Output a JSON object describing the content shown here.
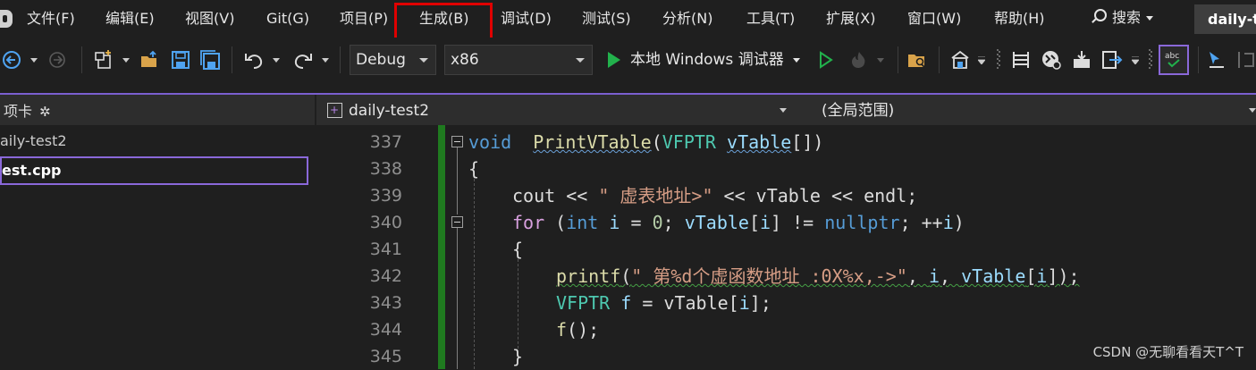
{
  "menubar": {
    "items": [
      {
        "label": "文件(F)"
      },
      {
        "label": "编辑(E)"
      },
      {
        "label": "视图(V)"
      },
      {
        "label": "Git(G)"
      },
      {
        "label": "项目(P)"
      },
      {
        "label": "生成(B)"
      },
      {
        "label": "调试(D)"
      },
      {
        "label": "测试(S)"
      },
      {
        "label": "分析(N)"
      },
      {
        "label": "工具(T)"
      },
      {
        "label": "扩展(X)"
      },
      {
        "label": "窗口(W)"
      },
      {
        "label": "帮助(H)"
      }
    ],
    "highlighted_item": "生成(B)",
    "highlight_color": "#e00000",
    "search_label": "搜索",
    "solution_name": "daily-t"
  },
  "toolbar": {
    "configuration": "Debug",
    "platform": "x86",
    "debugger_label": "本地 Windows 调试器",
    "icons": [
      "back-icon",
      "forward-icon",
      "new-project-icon",
      "open-file-icon",
      "save-icon",
      "save-all-icon",
      "undo-icon",
      "redo-icon",
      "start-debug-icon",
      "start-without-debug-icon",
      "hot-reload-icon",
      "find-in-files-icon",
      "toolbar-icon-a",
      "toolbar-icon-b",
      "toolbar-icon-c",
      "toolbar-icon-d",
      "toolbar-icon-e",
      "spell-check-icon",
      "pointer-icon"
    ]
  },
  "left_panel": {
    "header": "项卡",
    "items": [
      {
        "label": "aily-test2",
        "selected": false
      },
      {
        "label": "est.cpp",
        "selected": true
      }
    ]
  },
  "editor": {
    "file_combo": "daily-test2",
    "scope_combo": "(全局范围)",
    "lines": [
      {
        "num": "337",
        "tokens": [
          [
            "kw",
            "void"
          ],
          [
            "",
            "  "
          ],
          [
            "fn squig-b",
            "PrintVTable"
          ],
          [
            "",
            "("
          ],
          [
            "typ",
            "VFPTR"
          ],
          [
            "",
            " "
          ],
          [
            "par squig-b",
            "vTable"
          ],
          [
            "",
            "[])"
          ]
        ]
      },
      {
        "num": "338",
        "tokens": [
          [
            "",
            "{"
          ]
        ]
      },
      {
        "num": "339",
        "tokens": [
          [
            "",
            "cout << "
          ],
          [
            "str",
            "\" 虚表地址>\""
          ],
          [
            "",
            " << vTable << endl;"
          ]
        ]
      },
      {
        "num": "340",
        "tokens": [
          [
            "ctl",
            "for"
          ],
          [
            "",
            " ("
          ],
          [
            "kw",
            "int"
          ],
          [
            "",
            " "
          ],
          [
            "par",
            "i"
          ],
          [
            "",
            " = "
          ],
          [
            "num",
            "0"
          ],
          [
            "",
            "; "
          ],
          [
            "par",
            "vTable"
          ],
          [
            "",
            "["
          ],
          [
            "par",
            "i"
          ],
          [
            "",
            "] != "
          ],
          [
            "kw",
            "nullptr"
          ],
          [
            "",
            "; ++"
          ],
          [
            "par",
            "i"
          ],
          [
            "",
            ")"
          ]
        ]
      },
      {
        "num": "341",
        "tokens": [
          [
            "",
            "{"
          ]
        ]
      },
      {
        "num": "342",
        "tokens": [
          [
            "fn squig",
            "printf"
          ],
          [
            "squig",
            "("
          ],
          [
            "str squig",
            "\" 第%d个虚函数地址 :0X%x,->\""
          ],
          [
            "squig",
            ", "
          ],
          [
            "par squig",
            "i"
          ],
          [
            "squig",
            ", "
          ],
          [
            "par squig",
            "vTable"
          ],
          [
            "squig",
            "["
          ],
          [
            "par squig",
            "i"
          ],
          [
            "squig",
            "]);"
          ]
        ]
      },
      {
        "num": "343",
        "tokens": [
          [
            "typ",
            "VFPTR"
          ],
          [
            "",
            " "
          ],
          [
            "par",
            "f"
          ],
          [
            "",
            " = vTable["
          ],
          [
            "par",
            "i"
          ],
          [
            "",
            "];"
          ]
        ]
      },
      {
        "num": "344",
        "tokens": [
          [
            "fn",
            "f"
          ],
          [
            "",
            "();"
          ]
        ]
      },
      {
        "num": "345",
        "tokens": [
          [
            "",
            "}"
          ]
        ]
      }
    ]
  },
  "watermark": "CSDN @无聊看看天T^T",
  "colors": {
    "accent": "#7a5fcf",
    "change_bar": "#1f7a1f",
    "play_green": "#22b14c"
  }
}
